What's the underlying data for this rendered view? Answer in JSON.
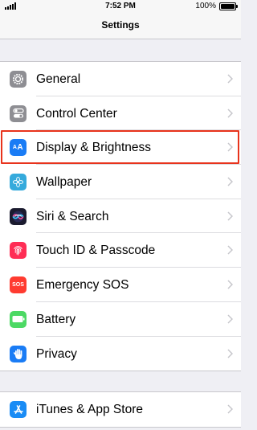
{
  "status_bar": {
    "time": "7:52 PM",
    "battery_percent": "100%",
    "battery_level": 1.0
  },
  "nav": {
    "title": "Settings"
  },
  "groups": [
    {
      "items": [
        {
          "label": "General",
          "icon": "gear-icon",
          "color": "#8e8e93"
        },
        {
          "label": "Control Center",
          "icon": "switches-icon",
          "color": "#8e8e93"
        },
        {
          "label": "Display & Brightness",
          "icon": "text-size-icon",
          "color": "#1a7cf5"
        },
        {
          "label": "Wallpaper",
          "icon": "flower-icon",
          "color": "#35aadc"
        },
        {
          "label": "Siri & Search",
          "icon": "siri-icon",
          "color": "#1b1b2f"
        },
        {
          "label": "Touch ID & Passcode",
          "icon": "fingerprint-icon",
          "color": "#ff2d55"
        },
        {
          "label": "Emergency SOS",
          "icon": "sos-icon",
          "color": "#ff3b30",
          "icon_text": "SOS"
        },
        {
          "label": "Battery",
          "icon": "battery-icon",
          "color": "#4cd964"
        },
        {
          "label": "Privacy",
          "icon": "hand-icon",
          "color": "#1a7cf5"
        }
      ]
    },
    {
      "items": [
        {
          "label": "iTunes & App Store",
          "icon": "app-store-icon",
          "color": "#1a8cf5"
        }
      ]
    }
  ],
  "highlight_color": "#e8331c"
}
